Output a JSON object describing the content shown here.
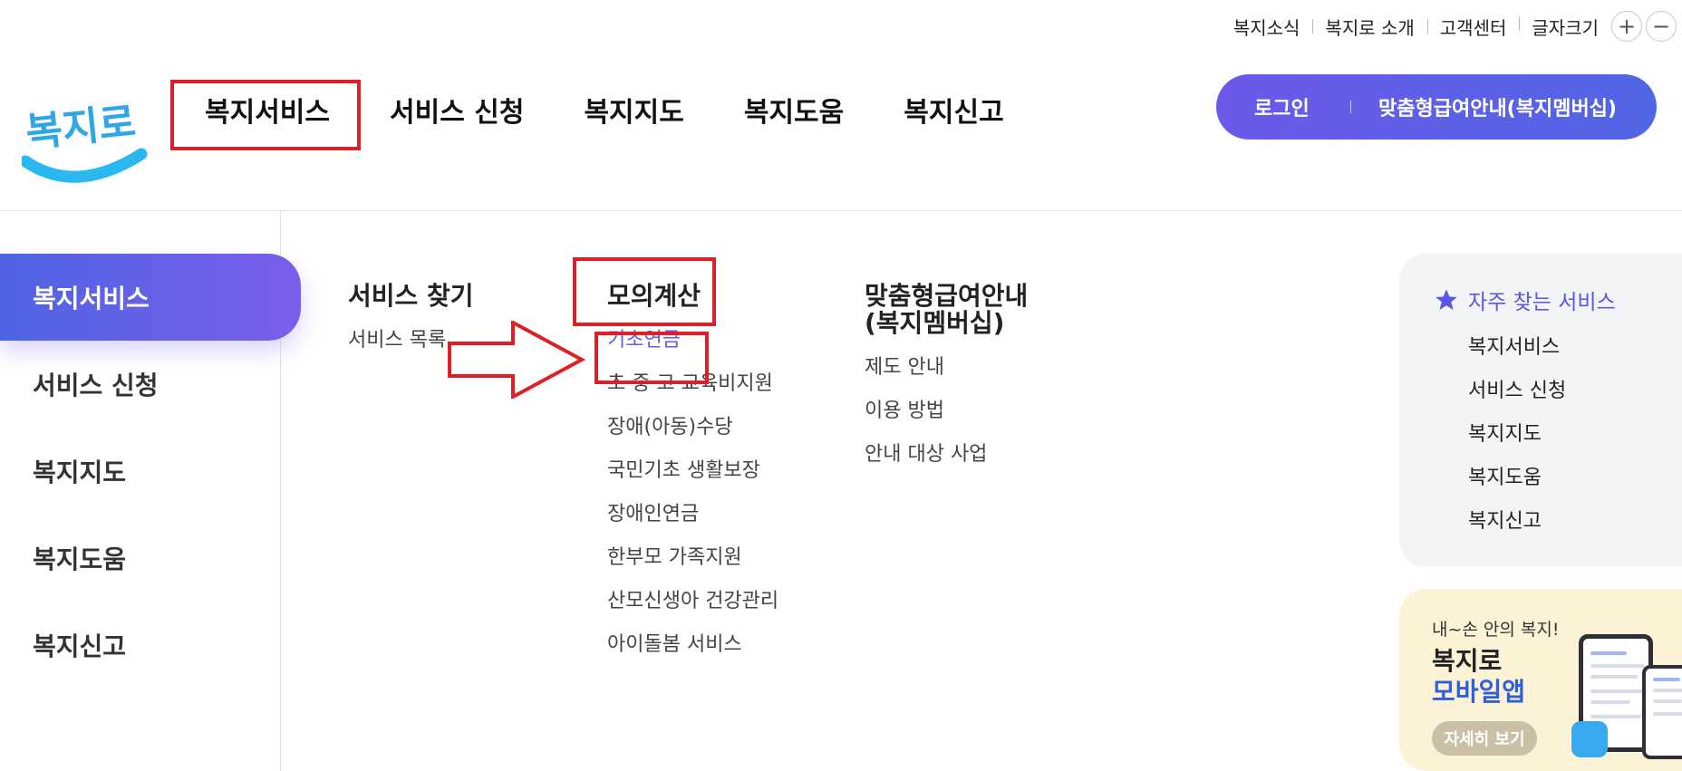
{
  "util_nav": {
    "links": [
      "복지소식",
      "복지로 소개",
      "고객센터"
    ],
    "font_size_label": "글자크기",
    "increase": "+",
    "decrease": "−"
  },
  "logo": {
    "text": "복지로"
  },
  "gnb": {
    "items": [
      "복지서비스",
      "서비스 신청",
      "복지지도",
      "복지도움",
      "복지신고"
    ]
  },
  "cta": {
    "login": "로그인",
    "membership": "맞춤형급여안내(복지멤버십)"
  },
  "lnb": {
    "items": [
      "복지서비스",
      "서비스 신청",
      "복지지도",
      "복지도움",
      "복지신고"
    ],
    "active": "복지서비스"
  },
  "menu": {
    "col1": {
      "title": "서비스 찾기",
      "links": [
        "서비스 목록"
      ]
    },
    "col2": {
      "title": "모의계산",
      "links": [
        "기초연금",
        "초·중·고 교육비지원",
        "장애(아동)수당",
        "국민기초 생활보장",
        "장애인연금",
        "한부모 가족지원",
        "산모신생아 건강관리",
        "아이돌봄 서비스"
      ]
    },
    "col3": {
      "title_line1": "맞춤형급여안내",
      "title_line2": "(복지멤버십)",
      "links": [
        "제도 안내",
        "이용 방법",
        "안내 대상 사업"
      ]
    }
  },
  "favorites": {
    "title": "자주 찾는 서비스",
    "items": [
      "복지서비스",
      "서비스 신청",
      "복지지도",
      "복지도움",
      "복지신고"
    ]
  },
  "app_banner": {
    "subtitle": "내~손 안의 복지!",
    "title_line1": "복지로",
    "title_line2": "모바일앱",
    "button": "자세히 보기"
  },
  "colors": {
    "accent": "#6a58e8",
    "gradient_start": "#4f64e4",
    "gradient_end": "#7a5eea",
    "annotation_red": "#e01e25"
  }
}
